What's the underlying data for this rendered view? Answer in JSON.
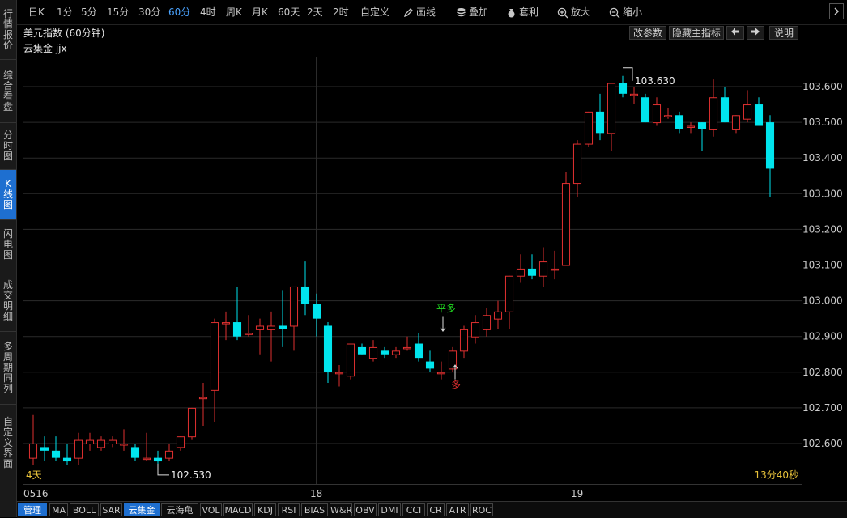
{
  "sidebar": {
    "items": [
      {
        "label": "行情报价",
        "active": false
      },
      {
        "label": "综合看盘",
        "active": false
      },
      {
        "label": "分时图",
        "active": false
      },
      {
        "label": "K线图",
        "active": true
      },
      {
        "label": "闪电图",
        "active": false
      },
      {
        "label": "成交明细",
        "active": false
      },
      {
        "label": "多周期同列",
        "active": false
      },
      {
        "label": "自定义界面",
        "active": false
      }
    ]
  },
  "toolbar": {
    "periods": [
      "日K",
      "1分",
      "5分",
      "15分",
      "30分",
      "60分",
      "4时",
      "周K",
      "月K",
      "60天",
      "2天",
      "2时",
      "自定义"
    ],
    "active_period": "60分",
    "draw_label": "画线",
    "overlay_label": "叠加",
    "arbitrage_label": "套利",
    "zoom_in_label": "放大",
    "zoom_out_label": "缩小"
  },
  "titlebar": {
    "title": "美元指数 (60分钟)",
    "params_button": "改参数",
    "hide_indicator_button": "隐藏主指标",
    "prev_icon": "arrow-left-icon",
    "next_icon": "arrow-right-icon",
    "help_button": "说明"
  },
  "indicator_line": "云集金 jjx",
  "chart": {
    "countdown": "13分40秒",
    "period_badge": "4天",
    "date_labels": [
      "0516",
      "18",
      "19"
    ],
    "high_marker": "103.630",
    "low_marker": "102.530",
    "signal_flat_long": "平多",
    "signal_long": "多",
    "colors": {
      "up": "#e03030",
      "down": "#00e5ee",
      "grid": "#2b2b2b",
      "axis_text": "#cccccc",
      "badge": "#e8c23a",
      "flat_long": "#22dd22",
      "long": "#e03030"
    }
  },
  "chart_data": {
    "type": "candlestick",
    "ylim": [
      102.5,
      103.65
    ],
    "y_ticks": [
      "103.600",
      "103.500",
      "103.400",
      "103.300",
      "103.200",
      "103.100",
      "103.000",
      "102.900",
      "102.800",
      "102.700",
      "102.600"
    ],
    "candles": [
      {
        "o": 102.56,
        "h": 102.68,
        "l": 102.54,
        "c": 102.6
      },
      {
        "o": 102.59,
        "h": 102.62,
        "l": 102.55,
        "c": 102.58
      },
      {
        "o": 102.58,
        "h": 102.62,
        "l": 102.55,
        "c": 102.56
      },
      {
        "o": 102.56,
        "h": 102.6,
        "l": 102.54,
        "c": 102.55
      },
      {
        "o": 102.56,
        "h": 102.63,
        "l": 102.54,
        "c": 102.61
      },
      {
        "o": 102.6,
        "h": 102.63,
        "l": 102.58,
        "c": 102.61
      },
      {
        "o": 102.59,
        "h": 102.62,
        "l": 102.58,
        "c": 102.61
      },
      {
        "o": 102.6,
        "h": 102.62,
        "l": 102.59,
        "c": 102.61
      },
      {
        "o": 102.6,
        "h": 102.64,
        "l": 102.58,
        "c": 102.6
      },
      {
        "o": 102.59,
        "h": 102.6,
        "l": 102.55,
        "c": 102.56
      },
      {
        "o": 102.56,
        "h": 102.63,
        "l": 102.55,
        "c": 102.56
      },
      {
        "o": 102.56,
        "h": 102.58,
        "l": 102.53,
        "c": 102.55
      },
      {
        "o": 102.56,
        "h": 102.6,
        "l": 102.55,
        "c": 102.58
      },
      {
        "o": 102.59,
        "h": 102.62,
        "l": 102.58,
        "c": 102.62
      },
      {
        "o": 102.62,
        "h": 102.7,
        "l": 102.61,
        "c": 102.7
      },
      {
        "o": 102.73,
        "h": 102.77,
        "l": 102.65,
        "c": 102.73
      },
      {
        "o": 102.75,
        "h": 102.95,
        "l": 102.66,
        "c": 102.94
      },
      {
        "o": 102.94,
        "h": 102.97,
        "l": 102.89,
        "c": 102.94
      },
      {
        "o": 102.94,
        "h": 103.04,
        "l": 102.89,
        "c": 102.9
      },
      {
        "o": 102.91,
        "h": 102.96,
        "l": 102.9,
        "c": 102.91
      },
      {
        "o": 102.92,
        "h": 102.95,
        "l": 102.85,
        "c": 102.93
      },
      {
        "o": 102.92,
        "h": 102.97,
        "l": 102.83,
        "c": 102.93
      },
      {
        "o": 102.93,
        "h": 103.03,
        "l": 102.87,
        "c": 102.92
      },
      {
        "o": 102.93,
        "h": 103.04,
        "l": 102.86,
        "c": 103.04
      },
      {
        "o": 103.04,
        "h": 103.11,
        "l": 102.96,
        "c": 102.99
      },
      {
        "o": 102.99,
        "h": 103.02,
        "l": 102.9,
        "c": 102.95
      },
      {
        "o": 102.93,
        "h": 102.94,
        "l": 102.77,
        "c": 102.8
      },
      {
        "o": 102.8,
        "h": 102.82,
        "l": 102.76,
        "c": 102.8
      },
      {
        "o": 102.79,
        "h": 102.88,
        "l": 102.78,
        "c": 102.88
      },
      {
        "o": 102.87,
        "h": 102.88,
        "l": 102.85,
        "c": 102.85
      },
      {
        "o": 102.84,
        "h": 102.89,
        "l": 102.83,
        "c": 102.87
      },
      {
        "o": 102.86,
        "h": 102.87,
        "l": 102.84,
        "c": 102.85
      },
      {
        "o": 102.85,
        "h": 102.87,
        "l": 102.84,
        "c": 102.86
      },
      {
        "o": 102.87,
        "h": 102.9,
        "l": 102.86,
        "c": 102.87
      },
      {
        "o": 102.88,
        "h": 102.91,
        "l": 102.83,
        "c": 102.84
      },
      {
        "o": 102.83,
        "h": 102.86,
        "l": 102.8,
        "c": 102.81
      },
      {
        "o": 102.8,
        "h": 102.83,
        "l": 102.78,
        "c": 102.8
      },
      {
        "o": 102.81,
        "h": 102.87,
        "l": 102.8,
        "c": 102.86
      },
      {
        "o": 102.86,
        "h": 102.93,
        "l": 102.84,
        "c": 102.92
      },
      {
        "o": 102.9,
        "h": 102.96,
        "l": 102.88,
        "c": 102.94
      },
      {
        "o": 102.92,
        "h": 102.98,
        "l": 102.9,
        "c": 102.96
      },
      {
        "o": 102.95,
        "h": 103.0,
        "l": 102.92,
        "c": 102.97
      },
      {
        "o": 102.97,
        "h": 103.07,
        "l": 102.92,
        "c": 103.07
      },
      {
        "o": 103.07,
        "h": 103.13,
        "l": 103.05,
        "c": 103.09
      },
      {
        "o": 103.09,
        "h": 103.13,
        "l": 103.06,
        "c": 103.07
      },
      {
        "o": 103.07,
        "h": 103.15,
        "l": 103.04,
        "c": 103.11
      },
      {
        "o": 103.09,
        "h": 103.14,
        "l": 103.06,
        "c": 103.09
      },
      {
        "o": 103.1,
        "h": 103.36,
        "l": 103.1,
        "c": 103.33
      },
      {
        "o": 103.33,
        "h": 103.45,
        "l": 103.29,
        "c": 103.44
      },
      {
        "o": 103.44,
        "h": 103.53,
        "l": 103.43,
        "c": 103.53
      },
      {
        "o": 103.53,
        "h": 103.58,
        "l": 103.45,
        "c": 103.47
      },
      {
        "o": 103.47,
        "h": 103.61,
        "l": 103.42,
        "c": 103.61
      },
      {
        "o": 103.61,
        "h": 103.63,
        "l": 103.57,
        "c": 103.58
      },
      {
        "o": 103.58,
        "h": 103.6,
        "l": 103.55,
        "c": 103.58
      },
      {
        "o": 103.57,
        "h": 103.58,
        "l": 103.5,
        "c": 103.5
      },
      {
        "o": 103.5,
        "h": 103.57,
        "l": 103.49,
        "c": 103.55
      },
      {
        "o": 103.52,
        "h": 103.54,
        "l": 103.51,
        "c": 103.52
      },
      {
        "o": 103.52,
        "h": 103.53,
        "l": 103.47,
        "c": 103.48
      },
      {
        "o": 103.49,
        "h": 103.5,
        "l": 103.47,
        "c": 103.49
      },
      {
        "o": 103.5,
        "h": 103.5,
        "l": 103.42,
        "c": 103.48
      },
      {
        "o": 103.48,
        "h": 103.62,
        "l": 103.46,
        "c": 103.57
      },
      {
        "o": 103.57,
        "h": 103.6,
        "l": 103.5,
        "c": 103.5
      },
      {
        "o": 103.48,
        "h": 103.52,
        "l": 103.47,
        "c": 103.52
      },
      {
        "o": 103.51,
        "h": 103.59,
        "l": 103.5,
        "c": 103.55
      },
      {
        "o": 103.55,
        "h": 103.57,
        "l": 103.49,
        "c": 103.49
      },
      {
        "o": 103.5,
        "h": 103.52,
        "l": 103.29,
        "c": 103.37
      }
    ]
  },
  "bottom_tabs": {
    "manage_label": "管理",
    "indicators": [
      "MA",
      "BOLL",
      "SAR",
      "云集金",
      "云海龟",
      "VOL",
      "MACD",
      "KDJ",
      "RSI",
      "BIAS",
      "W&R",
      "OBV",
      "DMI",
      "CCI",
      "CR",
      "ATR",
      "ROC"
    ],
    "active": "云集金"
  }
}
